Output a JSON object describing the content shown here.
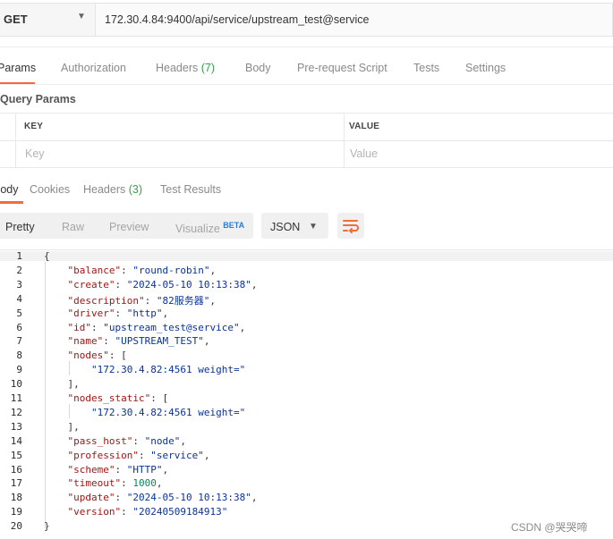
{
  "request": {
    "method": "GET",
    "url": "172.30.4.84:9400/api/service/upstream_test@service"
  },
  "request_tabs": [
    {
      "label": "Params",
      "count": ""
    },
    {
      "label": "Authorization",
      "count": ""
    },
    {
      "label": "Headers",
      "count": "(7)"
    },
    {
      "label": "Body",
      "count": ""
    },
    {
      "label": "Pre-request Script",
      "count": ""
    },
    {
      "label": "Tests",
      "count": ""
    },
    {
      "label": "Settings",
      "count": ""
    }
  ],
  "query_params": {
    "title": "Query Params",
    "key_header": "KEY",
    "value_header": "VALUE",
    "key_placeholder": "Key",
    "value_placeholder": "Value"
  },
  "response_tabs": [
    {
      "label": "Body",
      "count": ""
    },
    {
      "label": "Cookies",
      "count": ""
    },
    {
      "label": "Headers",
      "count": "(3)"
    },
    {
      "label": "Test Results",
      "count": ""
    }
  ],
  "view": {
    "pretty": "Pretty",
    "raw": "Raw",
    "preview": "Preview",
    "visualize": "Visualize",
    "beta": "BETA",
    "format": "JSON"
  },
  "code": {
    "lines": [
      {
        "n": "1",
        "indent": 0,
        "parts": [
          [
            "p",
            "{"
          ]
        ]
      },
      {
        "n": "2",
        "indent": 1,
        "parts": [
          [
            "k",
            "\"balance\""
          ],
          [
            "p",
            ": "
          ],
          [
            "s",
            "\"round-robin\""
          ],
          [
            "p",
            ","
          ]
        ]
      },
      {
        "n": "3",
        "indent": 1,
        "parts": [
          [
            "k",
            "\"create\""
          ],
          [
            "p",
            ": "
          ],
          [
            "s",
            "\"2024-05-10 10:13:38\""
          ],
          [
            "p",
            ","
          ]
        ]
      },
      {
        "n": "4",
        "indent": 1,
        "parts": [
          [
            "k",
            "\"description\""
          ],
          [
            "p",
            ": "
          ],
          [
            "s",
            "\"82服务器\""
          ],
          [
            "p",
            ","
          ]
        ]
      },
      {
        "n": "5",
        "indent": 1,
        "parts": [
          [
            "k",
            "\"driver\""
          ],
          [
            "p",
            ": "
          ],
          [
            "s",
            "\"http\""
          ],
          [
            "p",
            ","
          ]
        ]
      },
      {
        "n": "6",
        "indent": 1,
        "parts": [
          [
            "k",
            "\"id\""
          ],
          [
            "p",
            ": "
          ],
          [
            "s",
            "\"upstream_test@service\""
          ],
          [
            "p",
            ","
          ]
        ]
      },
      {
        "n": "7",
        "indent": 1,
        "parts": [
          [
            "k",
            "\"name\""
          ],
          [
            "p",
            ": "
          ],
          [
            "s",
            "\"UPSTREAM_TEST\""
          ],
          [
            "p",
            ","
          ]
        ]
      },
      {
        "n": "8",
        "indent": 1,
        "parts": [
          [
            "k",
            "\"nodes\""
          ],
          [
            "p",
            ": ["
          ]
        ]
      },
      {
        "n": "9",
        "indent": 2,
        "parts": [
          [
            "s",
            "\"172.30.4.82:4561 weight=\""
          ]
        ]
      },
      {
        "n": "10",
        "indent": 1,
        "parts": [
          [
            "p",
            "],"
          ]
        ]
      },
      {
        "n": "11",
        "indent": 1,
        "parts": [
          [
            "k",
            "\"nodes_static\""
          ],
          [
            "p",
            ": ["
          ]
        ]
      },
      {
        "n": "12",
        "indent": 2,
        "parts": [
          [
            "s",
            "\"172.30.4.82:4561 weight=\""
          ]
        ]
      },
      {
        "n": "13",
        "indent": 1,
        "parts": [
          [
            "p",
            "],"
          ]
        ]
      },
      {
        "n": "14",
        "indent": 1,
        "parts": [
          [
            "k",
            "\"pass_host\""
          ],
          [
            "p",
            ": "
          ],
          [
            "s",
            "\"node\""
          ],
          [
            "p",
            ","
          ]
        ]
      },
      {
        "n": "15",
        "indent": 1,
        "parts": [
          [
            "k",
            "\"profession\""
          ],
          [
            "p",
            ": "
          ],
          [
            "s",
            "\"service\""
          ],
          [
            "p",
            ","
          ]
        ]
      },
      {
        "n": "16",
        "indent": 1,
        "parts": [
          [
            "k",
            "\"scheme\""
          ],
          [
            "p",
            ": "
          ],
          [
            "s",
            "\"HTTP\""
          ],
          [
            "p",
            ","
          ]
        ]
      },
      {
        "n": "17",
        "indent": 1,
        "parts": [
          [
            "k",
            "\"timeout\""
          ],
          [
            "p",
            ": "
          ],
          [
            "n",
            "1000"
          ],
          [
            "p",
            ","
          ]
        ]
      },
      {
        "n": "18",
        "indent": 1,
        "parts": [
          [
            "k",
            "\"update\""
          ],
          [
            "p",
            ": "
          ],
          [
            "s",
            "\"2024-05-10 10:13:38\""
          ],
          [
            "p",
            ","
          ]
        ]
      },
      {
        "n": "19",
        "indent": 1,
        "parts": [
          [
            "k",
            "\"version\""
          ],
          [
            "p",
            ": "
          ],
          [
            "s",
            "\"20240509184913\""
          ]
        ]
      },
      {
        "n": "20",
        "indent": 0,
        "parts": [
          [
            "p",
            "}"
          ]
        ]
      }
    ]
  },
  "watermark": "CSDN @哭哭啼"
}
